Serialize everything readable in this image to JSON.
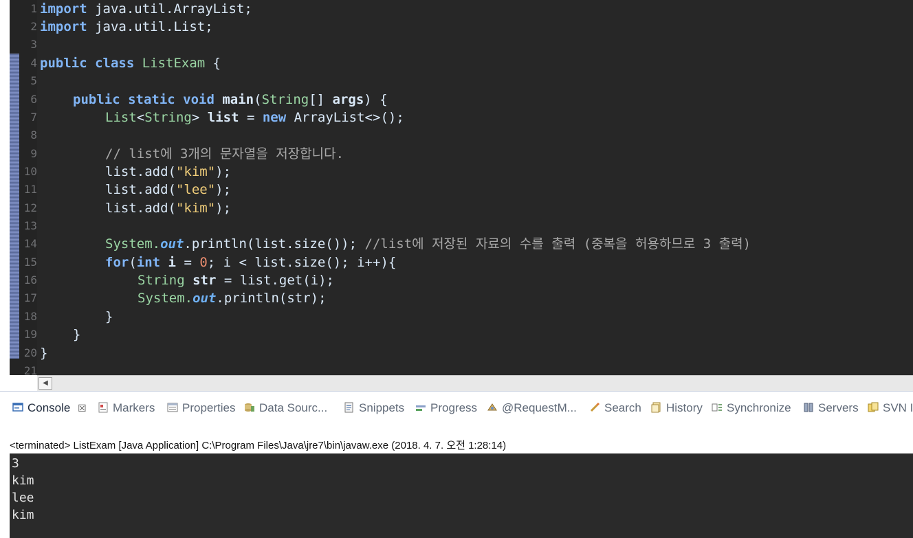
{
  "editor": {
    "line_numbers": [
      "1",
      "2",
      "3",
      "4",
      "5",
      "6",
      "7",
      "8",
      "9",
      "10",
      "11",
      "12",
      "13",
      "14",
      "15",
      "16",
      "17",
      "18",
      "19",
      "20",
      "21"
    ],
    "code": {
      "l1": {
        "kw": "import",
        "rest": " java.util.ArrayList;"
      },
      "l2": {
        "kw": "import",
        "rest": " java.util.List;"
      },
      "l4": {
        "kw": "public class",
        "name": " ListExam",
        "rest": " {"
      },
      "l6": {
        "kw": "public static void",
        "method": " main",
        "p1": "(",
        "type": "String",
        "p2": "[] ",
        "arg": "args",
        "p3": ") {"
      },
      "l7": {
        "type1": "List",
        "p1": "<",
        "type2": "String",
        "p2": "> ",
        "var": "list",
        "p3": " = ",
        "kw": "new",
        "p4": " ArrayList<>();"
      },
      "l9": {
        "comment": "// list에 3개의 문자열을 저장합니다."
      },
      "l10": {
        "pre": "list.add(",
        "str": "\"kim\"",
        "post": ");"
      },
      "l11": {
        "pre": "list.add(",
        "str": "\"lee\"",
        "post": ");"
      },
      "l12": {
        "pre": "list.add(",
        "str": "\"kim\"",
        "post": ");"
      },
      "l14": {
        "cls": "System.",
        "field": "out",
        "rest": ".println(list.size()); ",
        "comment": "//list에 저장된 자료의 수를 출력 (중복을 허용하므로 3 출력)"
      },
      "l15": {
        "kw": "for",
        "p1": "(",
        "kw2": "int",
        "var": " i",
        "p2": " = ",
        "num": "0",
        "p3": "; i < list.size(); i++){"
      },
      "l16": {
        "type": "String",
        "var": " str",
        "rest": " = list.get(i);"
      },
      "l17": {
        "cls": "System.",
        "field": "out",
        "rest": ".println(str);"
      },
      "l18": {
        "text": "}"
      },
      "l19": {
        "text": "}"
      },
      "l20": {
        "text": "}"
      }
    }
  },
  "views": {
    "tabs": [
      {
        "label": "Console",
        "icon": "console-icon"
      },
      {
        "label": "Markers",
        "icon": "markers-icon"
      },
      {
        "label": "Properties",
        "icon": "properties-icon"
      },
      {
        "label": "Data Sourc...",
        "icon": "data-source-icon"
      },
      {
        "label": "Snippets",
        "icon": "snippets-icon"
      },
      {
        "label": "Progress",
        "icon": "progress-icon"
      },
      {
        "label": "@RequestM...",
        "icon": "request-mapping-icon"
      },
      {
        "label": "Search",
        "icon": "search-icon"
      },
      {
        "label": "History",
        "icon": "history-icon"
      },
      {
        "label": "Synchronize",
        "icon": "synchronize-icon"
      },
      {
        "label": "Servers",
        "icon": "servers-icon"
      },
      {
        "label": "SVN I",
        "icon": "svn-icon"
      }
    ],
    "close_glyph": "☒"
  },
  "console": {
    "status": "<terminated> ListExam [Java Application] C:\\Program Files\\Java\\jre7\\bin\\javaw.exe (2018. 4. 7. 오전 1:28:14)",
    "output": [
      "3",
      "kim",
      "lee",
      "kim"
    ]
  },
  "colors": {
    "editor_bg": "#272727",
    "keyword": "#81b5f6",
    "string": "#f0cd7a",
    "type": "#9bd6a4",
    "comment": "#a8a8a8",
    "console_bg": "#2a2a2a"
  }
}
